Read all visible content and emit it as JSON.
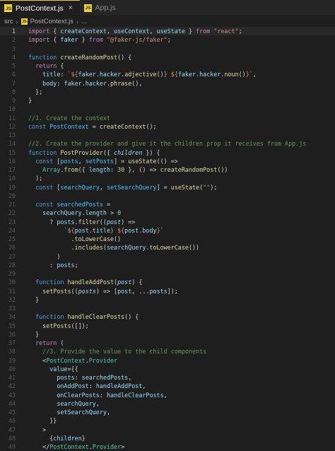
{
  "tabs": [
    {
      "label": "PostContext.js",
      "icon": "js-file-icon",
      "active": true,
      "close_glyph": "×"
    },
    {
      "label": "App.js",
      "icon": "js-file-icon",
      "active": false
    }
  ],
  "js_badge": "JS",
  "breadcrumb": {
    "folder": "src",
    "file": "PostContext.js",
    "more": "..."
  },
  "current_line": 1,
  "lines": [
    [
      [
        "import",
        "k"
      ],
      [
        " { ",
        "p"
      ],
      [
        "createContext",
        "v"
      ],
      [
        ", ",
        "p"
      ],
      [
        "useContext",
        "v"
      ],
      [
        ", ",
        "p"
      ],
      [
        "useState",
        "v"
      ],
      [
        " } ",
        "p"
      ],
      [
        "from",
        "k"
      ],
      [
        " ",
        "p"
      ],
      [
        "\"react\"",
        "s"
      ],
      [
        ";",
        "p"
      ]
    ],
    [
      [
        "import",
        "k"
      ],
      [
        " { ",
        "p"
      ],
      [
        "faker",
        "v"
      ],
      [
        " } ",
        "p"
      ],
      [
        "from",
        "k"
      ],
      [
        " ",
        "p"
      ],
      [
        "\"@faker-js/faker\"",
        "s"
      ],
      [
        ";",
        "p"
      ]
    ],
    [],
    [
      [
        "function",
        "b"
      ],
      [
        " ",
        "p"
      ],
      [
        "createRandomPost",
        "f"
      ],
      [
        "() {",
        "p"
      ]
    ],
    [
      [
        "  ",
        "p"
      ],
      [
        "return",
        "k"
      ],
      [
        " {",
        "p"
      ]
    ],
    [
      [
        "    ",
        "p"
      ],
      [
        "title",
        "v"
      ],
      [
        ": ",
        "p"
      ],
      [
        "`${",
        "s"
      ],
      [
        "faker",
        "v"
      ],
      [
        ".",
        "p"
      ],
      [
        "hacker",
        "v"
      ],
      [
        ".",
        "p"
      ],
      [
        "adjective",
        "f"
      ],
      [
        "()",
        "p"
      ],
      [
        "} ${",
        "s"
      ],
      [
        "faker",
        "v"
      ],
      [
        ".",
        "p"
      ],
      [
        "hacker",
        "v"
      ],
      [
        ".",
        "p"
      ],
      [
        "noun",
        "f"
      ],
      [
        "()",
        "p"
      ],
      [
        "}`",
        "s"
      ],
      [
        ",",
        "p"
      ]
    ],
    [
      [
        "    ",
        "p"
      ],
      [
        "body",
        "v"
      ],
      [
        ": ",
        "p"
      ],
      [
        "faker",
        "v"
      ],
      [
        ".",
        "p"
      ],
      [
        "hacker",
        "v"
      ],
      [
        ".",
        "p"
      ],
      [
        "phrase",
        "f"
      ],
      [
        "(),",
        "p"
      ]
    ],
    [
      [
        "  };",
        "p"
      ]
    ],
    [
      [
        "}",
        "p"
      ]
    ],
    [],
    [
      [
        "//1. Create the context",
        "cm"
      ]
    ],
    [
      [
        "const",
        "b"
      ],
      [
        " ",
        "p"
      ],
      [
        "PostContext",
        "c"
      ],
      [
        " = ",
        "p"
      ],
      [
        "createContext",
        "f"
      ],
      [
        "();",
        "p"
      ]
    ],
    [],
    [
      [
        "//2. Create the provider and give it the children prop it receives from App.js",
        "cm"
      ]
    ],
    [
      [
        "function",
        "b"
      ],
      [
        " ",
        "p"
      ],
      [
        "PostProvider",
        "f"
      ],
      [
        "({ ",
        "p"
      ],
      [
        "children",
        "v i"
      ],
      [
        " }) {",
        "p"
      ]
    ],
    [
      [
        "  ",
        "p"
      ],
      [
        "const",
        "b"
      ],
      [
        " [",
        "p"
      ],
      [
        "posts",
        "c"
      ],
      [
        ", ",
        "p"
      ],
      [
        "setPosts",
        "c"
      ],
      [
        "] = ",
        "p"
      ],
      [
        "useState",
        "f"
      ],
      [
        "(() =>",
        "p"
      ]
    ],
    [
      [
        "    ",
        "p"
      ],
      [
        "Array",
        "t"
      ],
      [
        ".",
        "p"
      ],
      [
        "from",
        "f"
      ],
      [
        "({ ",
        "p"
      ],
      [
        "length",
        "v"
      ],
      [
        ": ",
        "p"
      ],
      [
        "30",
        "n"
      ],
      [
        " }, () => ",
        "p"
      ],
      [
        "createRandomPost",
        "f"
      ],
      [
        "())",
        "p"
      ]
    ],
    [
      [
        "  );",
        "p"
      ]
    ],
    [
      [
        "  ",
        "p"
      ],
      [
        "const",
        "b"
      ],
      [
        " [",
        "p"
      ],
      [
        "searchQuery",
        "c"
      ],
      [
        ", ",
        "p"
      ],
      [
        "setSearchQuery",
        "c"
      ],
      [
        "] = ",
        "p"
      ],
      [
        "useState",
        "f"
      ],
      [
        "(",
        "p"
      ],
      [
        "\"\"",
        "s"
      ],
      [
        ");",
        "p"
      ]
    ],
    [],
    [
      [
        "  ",
        "p"
      ],
      [
        "const",
        "b"
      ],
      [
        " ",
        "p"
      ],
      [
        "searchedPosts",
        "c"
      ],
      [
        " =",
        "p"
      ]
    ],
    [
      [
        "    ",
        "p"
      ],
      [
        "searchQuery",
        "v"
      ],
      [
        ".",
        "p"
      ],
      [
        "length",
        "v"
      ],
      [
        " > ",
        "p"
      ],
      [
        "0",
        "n"
      ]
    ],
    [
      [
        "      ? ",
        "p"
      ],
      [
        "posts",
        "v"
      ],
      [
        ".",
        "p"
      ],
      [
        "filter",
        "f"
      ],
      [
        "((",
        "p"
      ],
      [
        "post",
        "v i"
      ],
      [
        ") =>",
        "p"
      ]
    ],
    [
      [
        "          ",
        "p"
      ],
      [
        "`${",
        "s"
      ],
      [
        "post",
        "v"
      ],
      [
        ".",
        "p"
      ],
      [
        "title",
        "v"
      ],
      [
        "} ${",
        "s"
      ],
      [
        "post",
        "v"
      ],
      [
        ".",
        "p"
      ],
      [
        "body",
        "v"
      ],
      [
        "}`",
        "s"
      ]
    ],
    [
      [
        "            .",
        "p"
      ],
      [
        "toLowerCase",
        "f"
      ],
      [
        "()",
        "p"
      ]
    ],
    [
      [
        "            .",
        "p"
      ],
      [
        "includes",
        "f"
      ],
      [
        "(",
        "p"
      ],
      [
        "searchQuery",
        "v"
      ],
      [
        ".",
        "p"
      ],
      [
        "toLowerCase",
        "f"
      ],
      [
        "())",
        "p"
      ]
    ],
    [
      [
        "        )",
        "p"
      ]
    ],
    [
      [
        "      : ",
        "p"
      ],
      [
        "posts",
        "v"
      ],
      [
        ";",
        "p"
      ]
    ],
    [],
    [
      [
        "  ",
        "p"
      ],
      [
        "function",
        "b"
      ],
      [
        " ",
        "p"
      ],
      [
        "handleAddPost",
        "f"
      ],
      [
        "(",
        "p"
      ],
      [
        "post",
        "v i"
      ],
      [
        ") {",
        "p"
      ]
    ],
    [
      [
        "    ",
        "p"
      ],
      [
        "setPosts",
        "f"
      ],
      [
        "((",
        "p"
      ],
      [
        "posts",
        "v i"
      ],
      [
        ") => [",
        "p"
      ],
      [
        "post",
        "v"
      ],
      [
        ", ...",
        "p"
      ],
      [
        "posts",
        "v"
      ],
      [
        "]);",
        "p"
      ]
    ],
    [
      [
        "  }",
        "p"
      ]
    ],
    [],
    [
      [
        "  ",
        "p"
      ],
      [
        "function",
        "b"
      ],
      [
        " ",
        "p"
      ],
      [
        "handleClearPosts",
        "f"
      ],
      [
        "() {",
        "p"
      ]
    ],
    [
      [
        "    ",
        "p"
      ],
      [
        "setPosts",
        "f"
      ],
      [
        "([]);",
        "p"
      ]
    ],
    [
      [
        "  }",
        "p"
      ]
    ],
    [
      [
        "  ",
        "p"
      ],
      [
        "return",
        "k"
      ],
      [
        " (",
        "p"
      ]
    ],
    [
      [
        "    ",
        "p"
      ],
      [
        "//3. Provide the value to the child components",
        "cm"
      ]
    ],
    [
      [
        "    ",
        "p"
      ],
      [
        "<",
        "p"
      ],
      [
        "PostContext",
        "t"
      ],
      [
        ".",
        "p"
      ],
      [
        "Provider",
        "t"
      ]
    ],
    [
      [
        "      ",
        "p"
      ],
      [
        "value",
        "v"
      ],
      [
        "={{",
        "p"
      ]
    ],
    [
      [
        "        ",
        "p"
      ],
      [
        "posts",
        "v"
      ],
      [
        ": ",
        "p"
      ],
      [
        "searchedPosts",
        "v"
      ],
      [
        ",",
        "p"
      ]
    ],
    [
      [
        "        ",
        "p"
      ],
      [
        "onAddPost",
        "v"
      ],
      [
        ": ",
        "p"
      ],
      [
        "handleAddPost",
        "v"
      ],
      [
        ",",
        "p"
      ]
    ],
    [
      [
        "        ",
        "p"
      ],
      [
        "onClearPosts",
        "v"
      ],
      [
        ": ",
        "p"
      ],
      [
        "handleClearPosts",
        "v"
      ],
      [
        ",",
        "p"
      ]
    ],
    [
      [
        "        ",
        "p"
      ],
      [
        "searchQuery",
        "v"
      ],
      [
        ",",
        "p"
      ]
    ],
    [
      [
        "        ",
        "p"
      ],
      [
        "setSearchQuery",
        "v"
      ],
      [
        ",",
        "p"
      ]
    ],
    [
      [
        "      }}",
        "p"
      ]
    ],
    [
      [
        "    >",
        "p"
      ]
    ],
    [
      [
        "      {",
        "p"
      ],
      [
        "children",
        "v"
      ],
      [
        "}",
        "p"
      ]
    ],
    [
      [
        "    </",
        "p"
      ],
      [
        "PostContext",
        "t"
      ],
      [
        ".",
        "p"
      ],
      [
        "Provider",
        "t"
      ],
      [
        ">",
        "p"
      ]
    ]
  ],
  "colors": {
    "background": "#1e1e1e",
    "keyword": "#c586c0",
    "storage": "#569cd6",
    "function": "#dcdcaa",
    "variable": "#9cdcfe",
    "constant": "#4fc1ff",
    "string": "#ce9178",
    "number": "#b5cea8",
    "comment": "#6a9955",
    "type": "#4ec9b0"
  }
}
